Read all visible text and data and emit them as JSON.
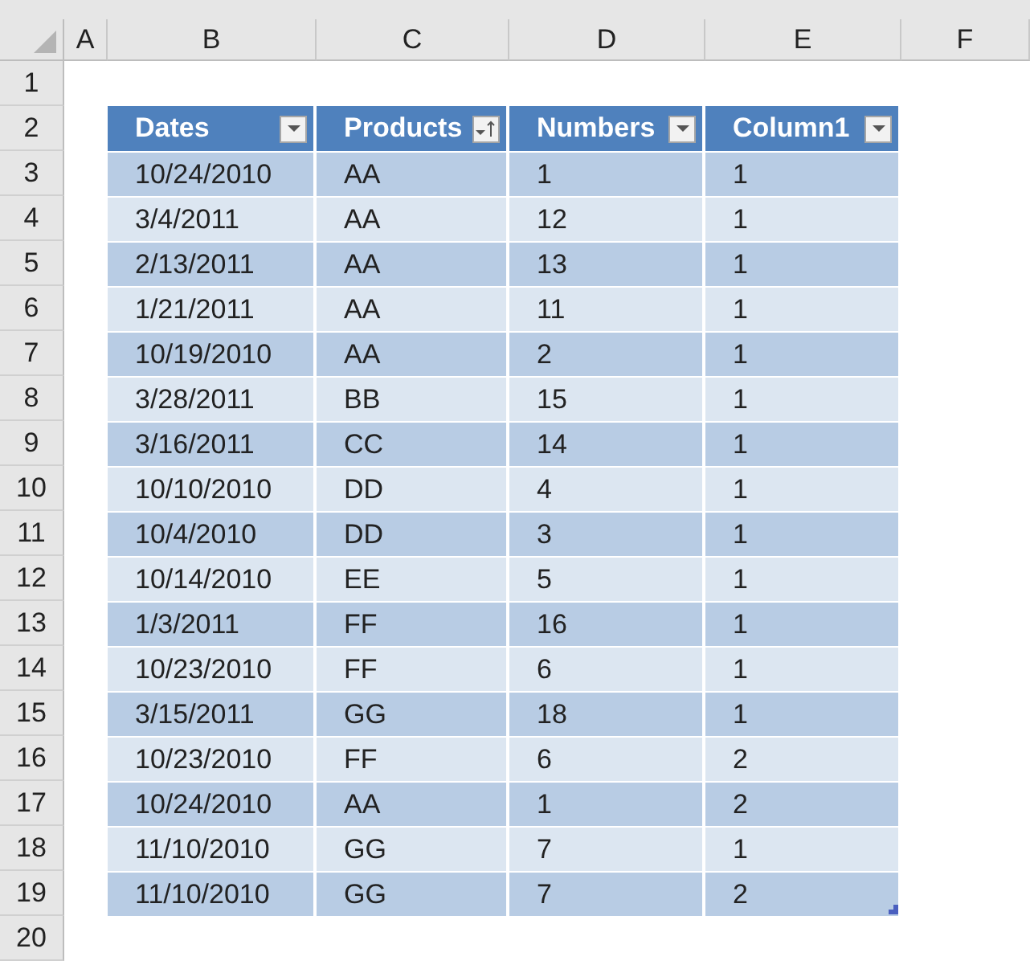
{
  "column_headings": [
    "A",
    "B",
    "C",
    "D",
    "E",
    "F"
  ],
  "row_numbers": [
    "1",
    "2",
    "3",
    "4",
    "5",
    "6",
    "7",
    "8",
    "9",
    "10",
    "11",
    "12",
    "13",
    "14",
    "15",
    "16",
    "17",
    "18",
    "19",
    "20"
  ],
  "table": {
    "columns": [
      {
        "name": "Dates",
        "kind": "filter"
      },
      {
        "name": "Products",
        "kind": "sorted"
      },
      {
        "name": "Numbers",
        "kind": "filter"
      },
      {
        "name": "Column1",
        "kind": "filter"
      }
    ],
    "rows": [
      [
        "10/24/2010",
        "AA",
        "1",
        "1"
      ],
      [
        "3/4/2011",
        "AA",
        "12",
        "1"
      ],
      [
        "2/13/2011",
        "AA",
        "13",
        "1"
      ],
      [
        "1/21/2011",
        "AA",
        "11",
        "1"
      ],
      [
        "10/19/2010",
        "AA",
        "2",
        "1"
      ],
      [
        "3/28/2011",
        "BB",
        "15",
        "1"
      ],
      [
        "3/16/2011",
        "CC",
        "14",
        "1"
      ],
      [
        "10/10/2010",
        "DD",
        "4",
        "1"
      ],
      [
        "10/4/2010",
        "DD",
        "3",
        "1"
      ],
      [
        "10/14/2010",
        "EE",
        "5",
        "1"
      ],
      [
        "1/3/2011",
        "FF",
        "16",
        "1"
      ],
      [
        "10/23/2010",
        "FF",
        "6",
        "1"
      ],
      [
        "3/15/2011",
        "GG",
        "18",
        "1"
      ],
      [
        "10/23/2010",
        "FF",
        "6",
        "2"
      ],
      [
        "10/24/2010",
        "AA",
        "1",
        "2"
      ],
      [
        "11/10/2010",
        "GG",
        "7",
        "1"
      ],
      [
        "11/10/2010",
        "GG",
        "7",
        "2"
      ]
    ]
  }
}
